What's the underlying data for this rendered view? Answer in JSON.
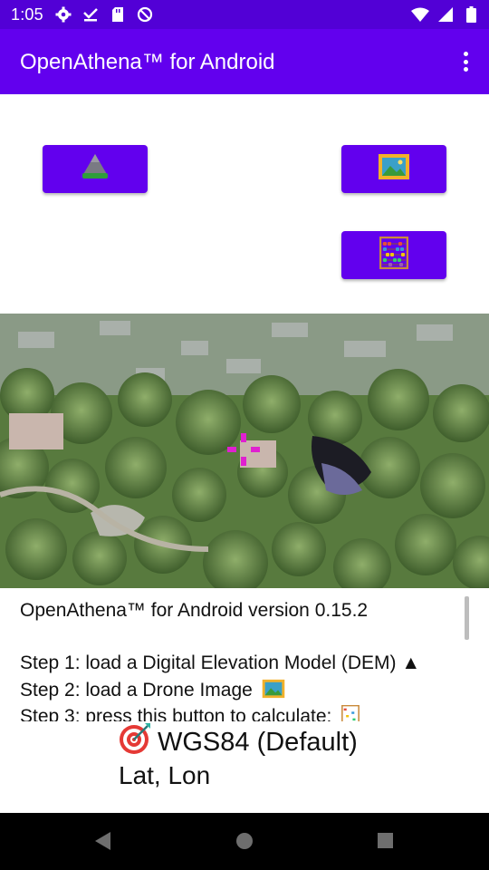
{
  "status_bar": {
    "time": "1:05",
    "left_icons": [
      "gear-icon",
      "download-done-icon",
      "sd-card-icon",
      "no-sync-icon"
    ],
    "right_icons": [
      "wifi-icon",
      "cell-signal-icon",
      "battery-icon"
    ]
  },
  "app_bar": {
    "title": "OpenAthena™ for Android",
    "menu_icon": "overflow-menu-icon"
  },
  "buttons": {
    "load_dem_icon": "mountain-icon",
    "load_image_icon": "framed-picture-icon",
    "calculate_icon": "abacus-icon"
  },
  "log": {
    "version_line": "OpenAthena™ for Android version 0.15.2",
    "step1": "Step 1: load a Digital Elevation Model (DEM) ▲",
    "step2_prefix": "Step 2: load a Drone Image",
    "step3_prefix": "Step 3: press this button to calculate:"
  },
  "coordinate_system": {
    "icon": "target-icon",
    "label": "WGS84 (Default)",
    "format": "Lat, Lon"
  },
  "colors": {
    "primary": "#6200ee",
    "primary_dark": "#5200d6",
    "crosshair": "#e020d0"
  },
  "nav_bar": {
    "icons": [
      "back-icon",
      "home-icon",
      "recents-icon"
    ]
  }
}
